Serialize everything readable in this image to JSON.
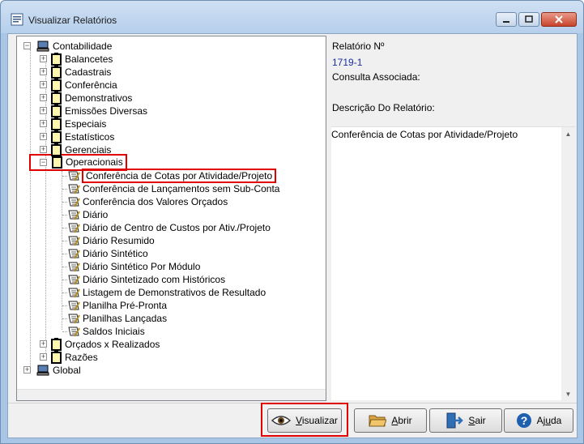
{
  "window": {
    "title": "Visualizar Relatórios"
  },
  "tree": {
    "root1": "Contabilidade",
    "folders_before": [
      "Balancetes",
      "Cadastrais",
      "Conferência",
      "Demonstrativos",
      "Emissões Diversas",
      "Especiais",
      "Estatísticos",
      "Gerenciais"
    ],
    "expanded_folder": "Operacionais",
    "reports": [
      "Conferência de Cotas por Atividade/Projeto",
      "Conferência de Lançamentos sem Sub-Conta",
      "Conferência dos Valores Orçados",
      "Diário",
      "Diário de Centro de Custos por Ativ./Projeto",
      "Diário Resumido",
      "Diário Sintético",
      "Diário Sintético Por Módulo",
      "Diário Sintetizado com Históricos",
      "Listagem de Demonstrativos de Resultado",
      "Planilha Pré-Pronta",
      "Planilhas Lançadas",
      "Saldos Iniciais"
    ],
    "folders_after": [
      "Orçados x Realizados",
      "Razões"
    ],
    "root2": "Global"
  },
  "info": {
    "report_number_label": "Relatório Nº",
    "report_number": "1719-1",
    "consulta_label": "Consulta Associada:",
    "descricao_label": "Descrição Do Relatório:",
    "descricao": "Conferência de Cotas por Atividade/Projeto"
  },
  "buttons": {
    "visualizar_pre": "",
    "visualizar_u": "V",
    "visualizar_post": "isualizar",
    "abrir_u": "A",
    "abrir_post": "brir",
    "sair_u": "S",
    "sair_post": "air",
    "ajuda_pre": "Aj",
    "ajuda_u": "u",
    "ajuda_post": "da"
  },
  "colors": {
    "highlight": "#e00000",
    "value_blue": "#1a2f9b",
    "titlebar": "#b6cfeb"
  },
  "icons": {
    "app": "report-app-icon",
    "computer": "computer-icon",
    "folder": "clipboard-folder-icon",
    "report": "report-pen-icon",
    "visualizar": "eye-icon",
    "abrir": "open-folder-icon",
    "sair": "exit-door-icon",
    "ajuda": "help-icon"
  }
}
